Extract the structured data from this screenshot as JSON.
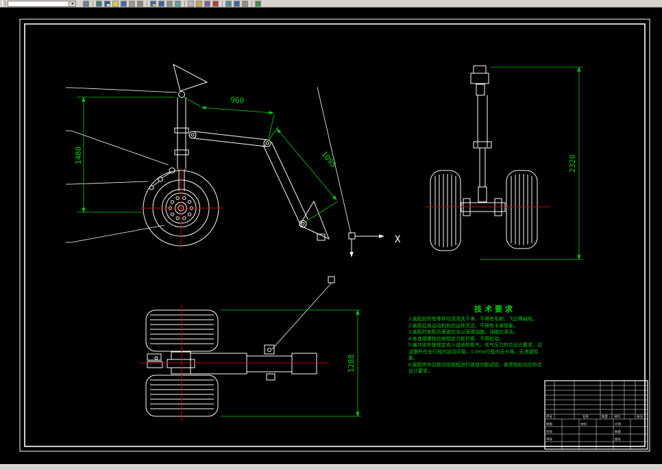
{
  "toolbar": {
    "combo": {
      "value": ""
    },
    "icons": [
      {
        "name": "layers",
        "color": "#6b7f9e"
      },
      {
        "sep": true
      },
      {
        "name": "make-layer-current",
        "color": "#3f7f7f"
      },
      {
        "name": "layer-previous",
        "color": "#2f5f8f",
        "accent": "#e8e4d8"
      },
      {
        "name": "zoom-window",
        "color": "#d9c94a"
      },
      {
        "name": "zoom-previous",
        "color": "#4a69a5"
      },
      {
        "name": "pan",
        "color": "#9a9a92"
      },
      {
        "name": "orbit",
        "color": "#8a8a82"
      },
      {
        "sep": true
      },
      {
        "name": "undo",
        "color": "#3a66a8",
        "accent": "#d9c94a"
      },
      {
        "name": "redo",
        "color": "#3a66a8"
      },
      {
        "name": "plot",
        "color": "#8f8f87"
      },
      {
        "name": "plot-preview",
        "color": "#58a0a8"
      },
      {
        "sep": true
      },
      {
        "name": "copy",
        "color": "#b9b9b1"
      },
      {
        "name": "paste",
        "color": "#caa94a"
      },
      {
        "name": "match-properties",
        "color": "#7f5fa0"
      },
      {
        "name": "erase",
        "color": "#b04038"
      },
      {
        "sep": true
      },
      {
        "name": "properties",
        "color": "#4e8e98"
      },
      {
        "name": "design-center",
        "color": "#41699f"
      },
      {
        "name": "tool-palettes",
        "color": "#8f8f87"
      },
      {
        "sep": true
      },
      {
        "name": "help",
        "color": "#3e8e49"
      }
    ]
  },
  "drawing": {
    "dims": {
      "side_height": "1480",
      "top_link": "960",
      "brace": "1095",
      "front_height": "2320",
      "plan_height": "1288"
    },
    "axis_x_label": "X",
    "colors": {
      "geometry": "#ffffff",
      "dimension": "#00d200",
      "centerline": "#c80000",
      "background": "#000000"
    }
  },
  "tech": {
    "title": "技术要求",
    "lines": [
      "1.装配前所有零件均须清洗干净，不得有毛刺、飞边等缺陷。",
      "2.装配后各运动机构应运转灵活，不得有卡滞现象。",
      "3.装配时各配合表面应涂以润滑油脂，油脂应清洁。",
      "4.各连接螺栓应按规定力矩拧紧，不得松动。",
      "5.缓冲支柱按规定充入油液和氮气，充气压力符合设计要求、且",
      "  活塞杆在全行程内运动平稳，1.0mm行程内无卡滞、无渗漏现",
      "  象。",
      "6.装配完毕后按试验规程进行收放功能试验，各项指标均应符合",
      "  设计要求。"
    ]
  },
  "title_block": {
    "bom": [
      "序号",
      "名称",
      "数量",
      "材料",
      "备注"
    ],
    "drawn": "制图",
    "checked": "校核",
    "approved": "审核",
    "scale": "比例",
    "qty": "数量",
    "material": "材料",
    "sheet": "图号"
  }
}
